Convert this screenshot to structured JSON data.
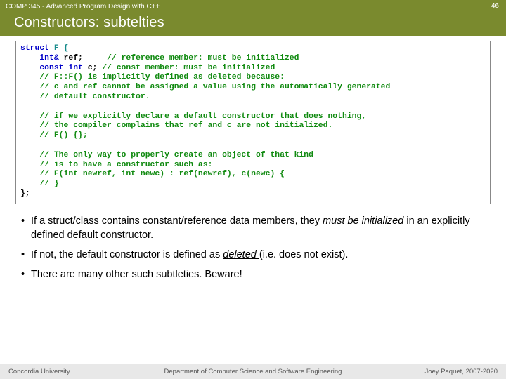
{
  "header": {
    "course": "COMP 345 - Advanced Program Design with C++",
    "page": "46",
    "title": "Constructors: subtelties"
  },
  "code": {
    "l01a": "struct",
    "l01b": " F {",
    "l02a": "    int& ",
    "l02b": "ref;     ",
    "l02c": "// reference member: must be initialized",
    "l03a": "    const int ",
    "l03b": "c; ",
    "l03c": "// const member: must be initialized",
    "l04": "    // F::F() is implicitly defined as deleted because:",
    "l05": "    // c and ref cannot be assigned a value using the automatically generated",
    "l06": "    // default constructor.",
    "l08": "    // if we explicitly declare a default constructor that does nothing,",
    "l09": "    // the compiler complains that ref and c are not initialized.",
    "l10": "    // F() {};",
    "l12": "    // The only way to properly create an object of that kind",
    "l13": "    // is to have a constructor such as:",
    "l14": "    // F(int newref, int newc) : ref(newref), c(newc) {",
    "l15": "    // }",
    "l16": "};"
  },
  "bullets": {
    "b1a": "If a struct/class contains constant/reference data members, they ",
    "b1b": "must be initialized",
    "b1c": " in an explicitly defined default constructor.",
    "b2a": "If not, the default constructor is defined as ",
    "b2b": "deleted ",
    "b2c": "(i.e. does not exist).",
    "b3": "There are many other such subtleties. Beware!"
  },
  "footer": {
    "left": "Concordia University",
    "center": "Department of Computer Science and Software Engineering",
    "right": "Joey Paquet, 2007-2020"
  }
}
